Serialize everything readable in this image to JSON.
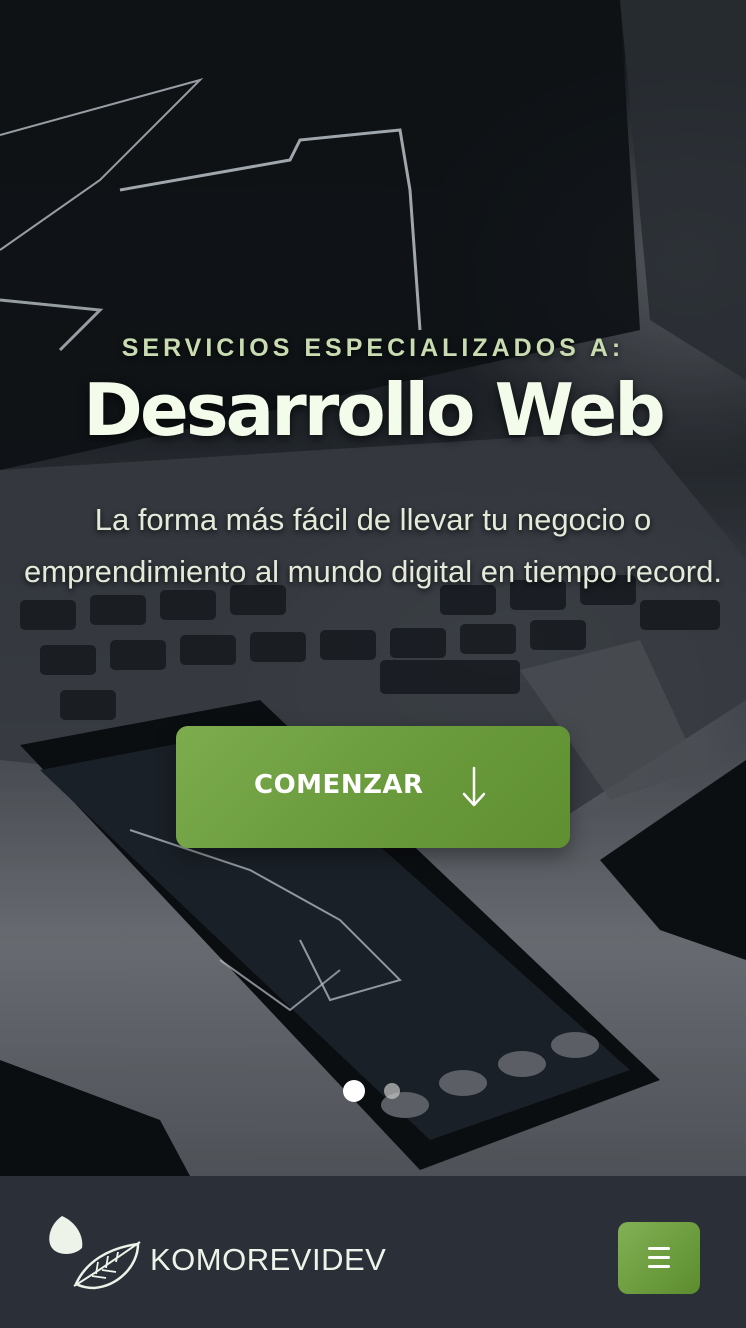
{
  "hero": {
    "eyebrow": "SERVICIOS ESPECIALIZADOS A:",
    "title": "Desarrollo Web",
    "subtitle": "La forma más fácil de llevar tu negocio o emprendimiento al mundo digital en tiempo record.",
    "cta_label": "COMENZAR",
    "cta_icon": "arrow-down-icon",
    "slides": {
      "count": 2,
      "active": 1
    }
  },
  "navbar": {
    "brand": "KOMOREVIDEV",
    "logo_icon": "leaf-icon",
    "menu_icon": "hamburger-menu-icon"
  },
  "colors": {
    "accent": "#6a9b3c",
    "eyebrow": "#c9dbb0",
    "navbar_bg": "#2b3038"
  }
}
